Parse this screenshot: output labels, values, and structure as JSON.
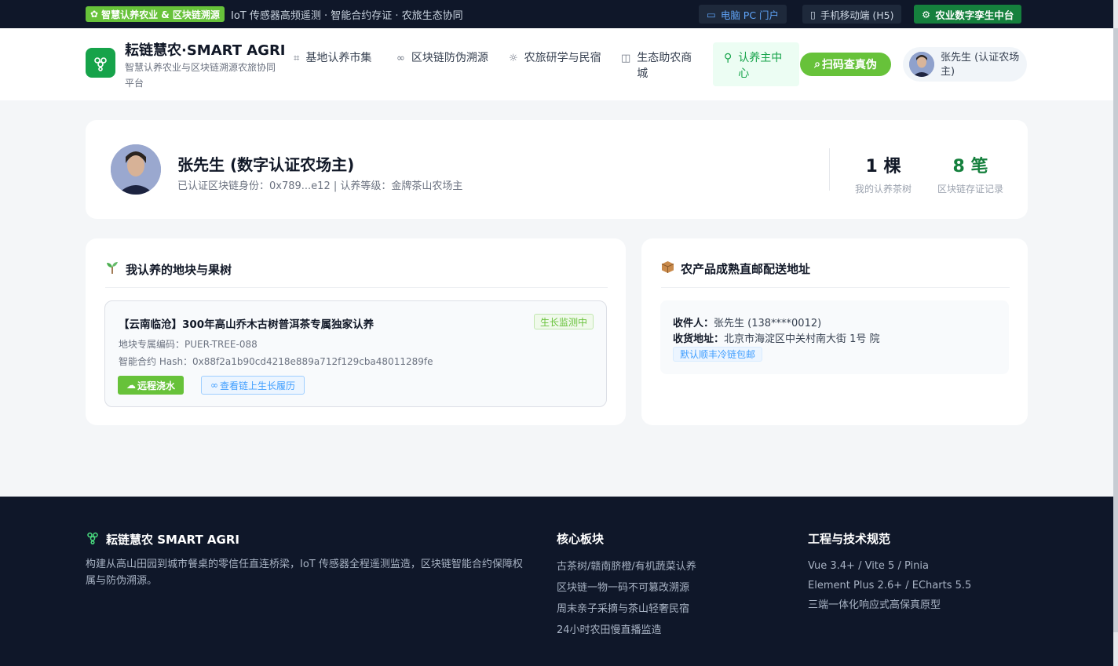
{
  "topbar": {
    "badge": "智慧认养农业 & 区块链溯源",
    "tagline": "IoT 传感器高频遥测 · 智能合约存证 · 农旅生态协同",
    "pc_portal": "电脑 PC 门户",
    "mobile": "手机移动端 (H5)",
    "twin_center": "农业数字孪生中台"
  },
  "header": {
    "brand_title": "耘链慧农·SMART AGRI",
    "brand_subtitle": "智慧认养农业与区块链溯源农旅协同平台",
    "nav": [
      {
        "label": "基地认养市集",
        "icon": "crop-icon"
      },
      {
        "label": "区块链防伪溯源",
        "icon": "link-icon"
      },
      {
        "label": "农旅研学与民宿",
        "icon": "sunrise-icon"
      },
      {
        "label": "生态助农商城",
        "icon": "shopping-bag-icon"
      },
      {
        "label": "认养主中心",
        "icon": "user-icon"
      }
    ],
    "scan_button": "扫码查真伪",
    "user_name": "张先生 (认证农场主)"
  },
  "profile": {
    "name": "张先生 (数字认证农场主)",
    "meta": "已认证区块链身份：0x789...e12 | 认养等级：金牌茶山农场主",
    "stats": [
      {
        "value": "1 棵",
        "label": "我的认养茶树"
      },
      {
        "value": "8 笔",
        "label": "区块链存证记录"
      }
    ]
  },
  "adoption": {
    "title": "我认养的地块与果树",
    "item": {
      "title": "【云南临沧】300年高山乔木古树普洱茶专属独家认养",
      "status": "生长监测中",
      "code": "地块专属编码：PUER-TREE-088",
      "hash": "智能合约 Hash：0x88f2a1b90cd4218e889a712f129cba48011289fe",
      "water_button": "远程浇水",
      "chain_button": "查看链上生长履历"
    }
  },
  "delivery": {
    "title": "农产品成熟直邮配送地址",
    "receiver_label": "收件人：",
    "receiver_value": "张先生 (138****0012)",
    "address_label": "收货地址：",
    "address_value": "北京市海淀区中关村南大街 1号 院",
    "shipping_tag": "默认顺丰冷链包邮"
  },
  "footer": {
    "brand": "耘链慧农 SMART AGRI",
    "description": "构建从高山田园到城市餐桌的零信任直连桥梁，IoT 传感器全程遥测监造，区块链智能合约保障权属与防伪溯源。",
    "col1_title": "核心板块",
    "col1_links": [
      "古茶树/赣南脐橙/有机蔬菜认养",
      "区块链一物一码不可篡改溯源",
      "周末亲子采摘与茶山轻奢民宿",
      "24小时农田慢直播监造"
    ],
    "col2_title": "工程与技术规范",
    "col2_links": [
      "Vue 3.4+ / Vite 5 / Pinia",
      "Element Plus 2.6+ / ECharts 5.5",
      "三端一体化响应式高保真原型"
    ]
  },
  "colors": {
    "primary_green": "#67c23a",
    "deep_green": "#15803d",
    "navy": "#0f1729",
    "link_blue": "#409eff"
  }
}
